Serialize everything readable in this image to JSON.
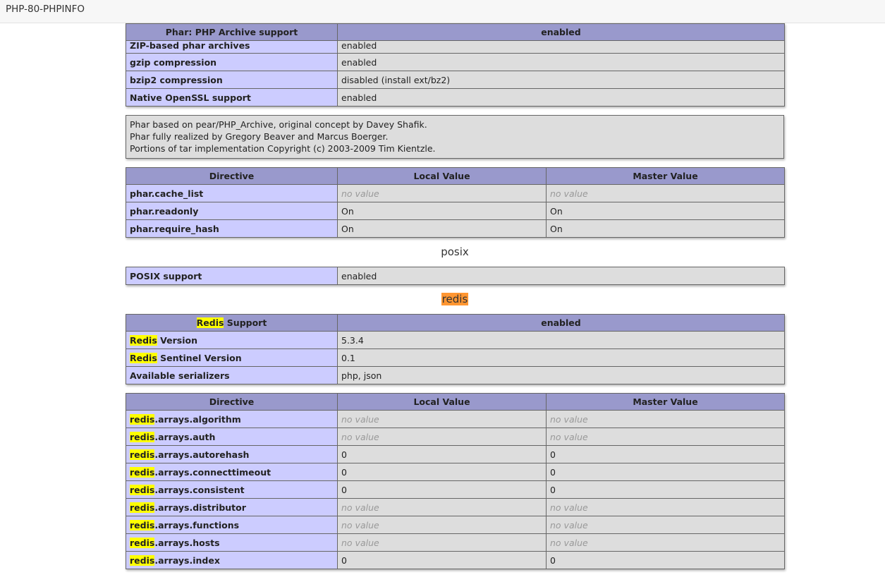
{
  "window": {
    "title": "PHP-80-PHPINFO"
  },
  "phar": {
    "header": {
      "label": "Phar: PHP Archive support",
      "value": "enabled"
    },
    "rows": [
      {
        "label": "ZIP-based phar archives",
        "value": "enabled"
      },
      {
        "label": "gzip compression",
        "value": "enabled"
      },
      {
        "label": "bzip2 compression",
        "value": "disabled (install ext/bz2)"
      },
      {
        "label": "Native OpenSSL support",
        "value": "enabled"
      }
    ],
    "credits": [
      "Phar based on pear/PHP_Archive, original concept by Davey Shafik.",
      "Phar fully realized by Gregory Beaver and Marcus Boerger.",
      "Portions of tar implementation Copyright (c) 2003-2009 Tim Kientzle."
    ],
    "directives_header": {
      "directive": "Directive",
      "local": "Local Value",
      "master": "Master Value"
    },
    "directives": [
      {
        "name": "phar.cache_list",
        "local": "no value",
        "master": "no value"
      },
      {
        "name": "phar.readonly",
        "local": "On",
        "master": "On"
      },
      {
        "name": "phar.require_hash",
        "local": "On",
        "master": "On"
      }
    ]
  },
  "posix": {
    "title": "posix",
    "rows": [
      {
        "label": "POSIX support",
        "value": "enabled"
      }
    ]
  },
  "redis": {
    "title": "redis",
    "highlight_term": "Redis",
    "highlight_term_lower": "redis",
    "header": {
      "label_suffix": " Support",
      "value": "enabled"
    },
    "rows": [
      {
        "label_suffix": " Version",
        "value": "5.3.4"
      },
      {
        "label_suffix": " Sentinel Version",
        "value": "0.1"
      }
    ],
    "serializers": {
      "label": "Available serializers",
      "value": "php, json"
    },
    "directives_header": {
      "directive": "Directive",
      "local": "Local Value",
      "master": "Master Value"
    },
    "directives": [
      {
        "suffix": ".arrays.algorithm",
        "local": "no value",
        "master": "no value"
      },
      {
        "suffix": ".arrays.auth",
        "local": "no value",
        "master": "no value"
      },
      {
        "suffix": ".arrays.autorehash",
        "local": "0",
        "master": "0"
      },
      {
        "suffix": ".arrays.connecttimeout",
        "local": "0",
        "master": "0"
      },
      {
        "suffix": ".arrays.consistent",
        "local": "0",
        "master": "0"
      },
      {
        "suffix": ".arrays.distributor",
        "local": "no value",
        "master": "no value"
      },
      {
        "suffix": ".arrays.functions",
        "local": "no value",
        "master": "no value"
      },
      {
        "suffix": ".arrays.hosts",
        "local": "no value",
        "master": "no value"
      },
      {
        "suffix": ".arrays.index",
        "local": "0",
        "master": "0"
      }
    ]
  },
  "colors": {
    "header_bg": "#9999cc",
    "label_bg": "#ccccff",
    "value_bg": "#dddddd",
    "search_highlight": "#ffff00",
    "search_current": "#ff9632"
  }
}
